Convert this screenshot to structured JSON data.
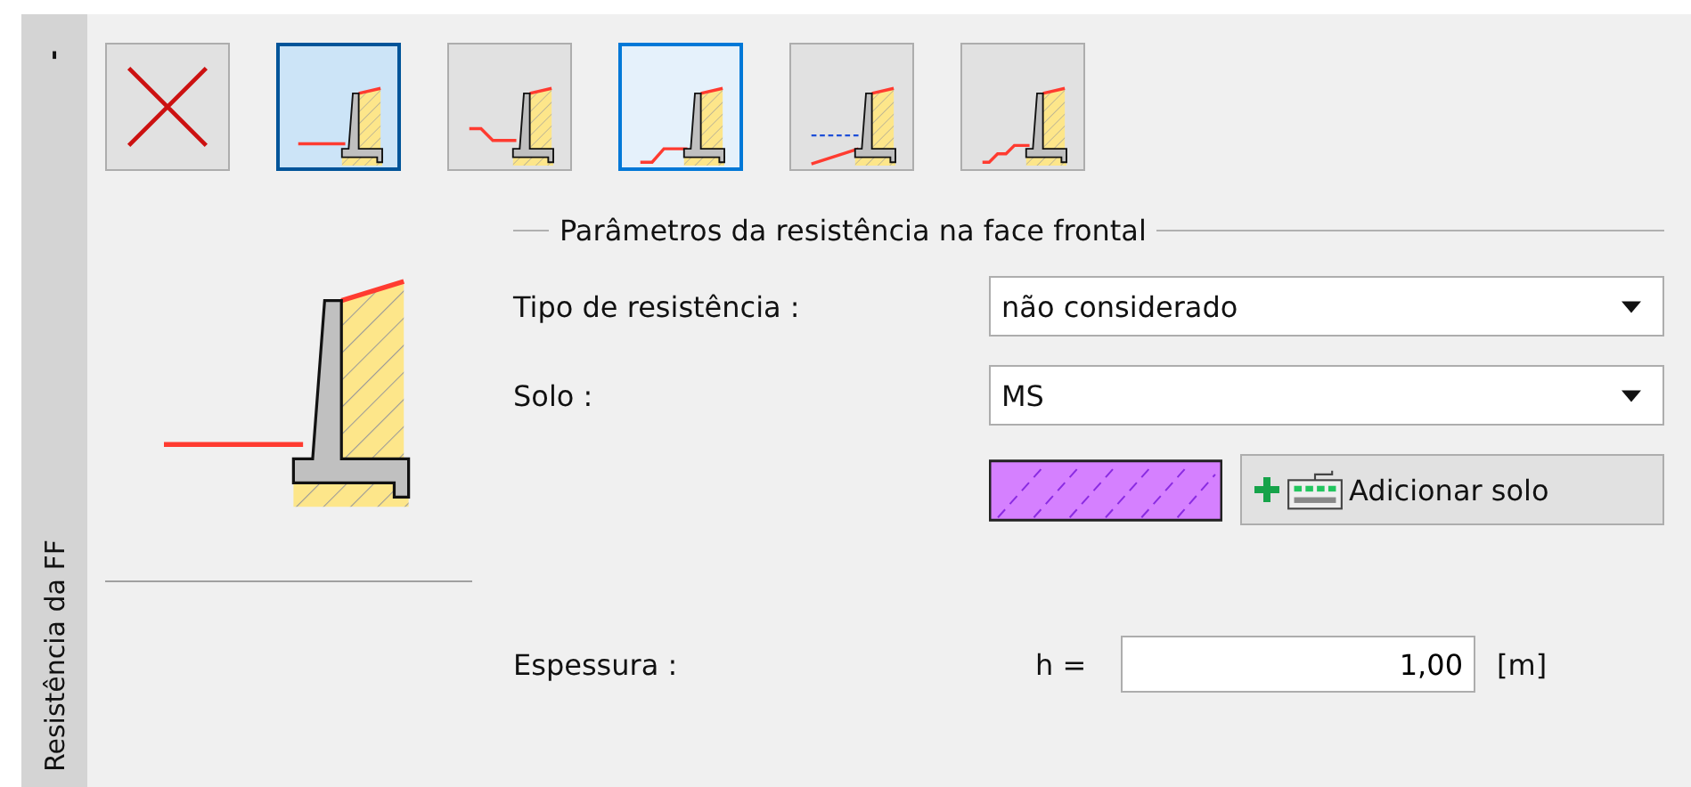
{
  "side_tab": {
    "collapse_label": "-",
    "title": "Resistência da FF"
  },
  "type_buttons": [
    {
      "kind": "none",
      "selected": false,
      "focused": false
    },
    {
      "kind": "flat",
      "selected": true,
      "focused": false
    },
    {
      "kind": "step_down",
      "selected": false,
      "focused": false
    },
    {
      "kind": "rising",
      "selected": false,
      "focused": true
    },
    {
      "kind": "water",
      "selected": false,
      "focused": false
    },
    {
      "kind": "stepped",
      "selected": false,
      "focused": false
    }
  ],
  "parameters": {
    "title": "Parâmetros da resistência na face frontal",
    "resistance_type": {
      "label": "Tipo de resistência :",
      "value": "não considerado"
    },
    "soil": {
      "label": "Solo :",
      "value": "MS"
    },
    "add_soil_button": "Adicionar solo",
    "thickness": {
      "label": "Espessura :",
      "symbol": "h =",
      "value": "1,00",
      "unit": "[m]"
    }
  }
}
